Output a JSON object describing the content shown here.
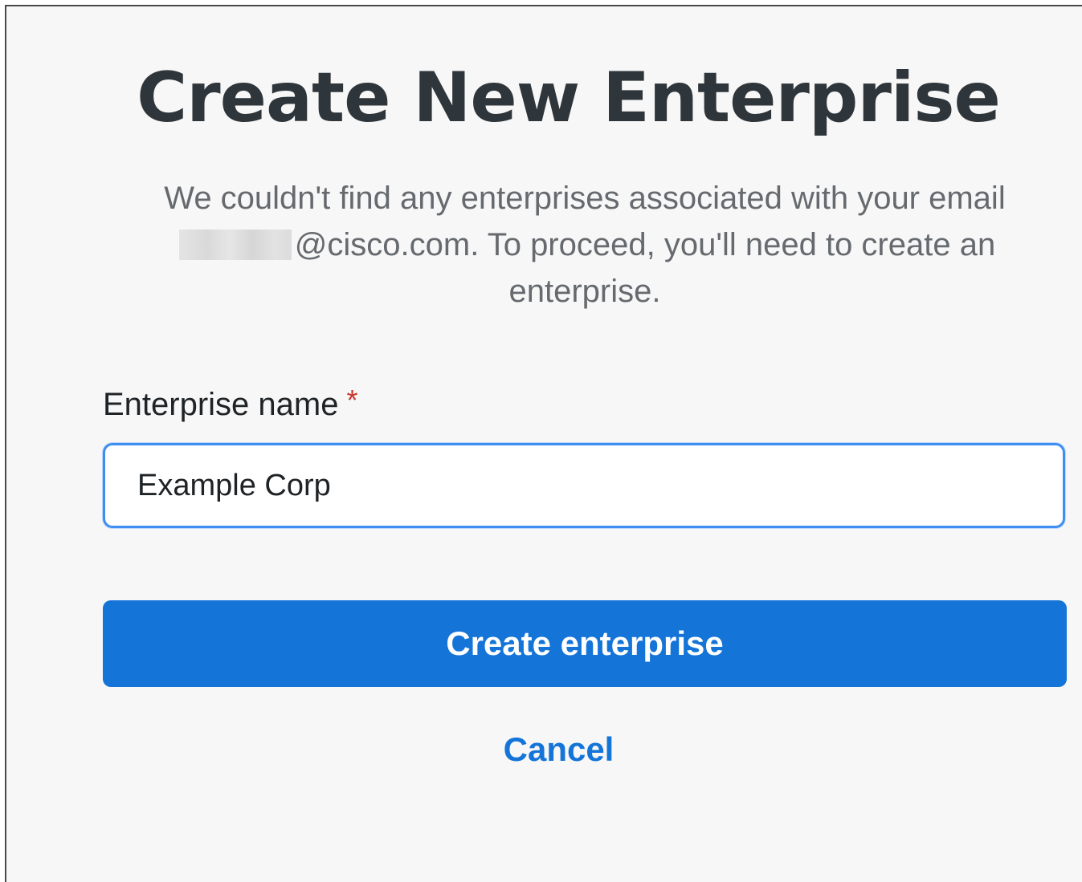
{
  "dialog": {
    "title": "Create New Enterprise",
    "description_prefix": "We couldn't find any enterprises associated with your email",
    "description_suffix": "@cisco.com. To proceed, you'll need to create an enterprise."
  },
  "form": {
    "field_label": "Enterprise name",
    "required_marker": "*",
    "input_value": "Example Corp"
  },
  "actions": {
    "submit_label": "Create enterprise",
    "cancel_label": "Cancel"
  },
  "colors": {
    "accent": "#1474d8",
    "required": "#c8382b",
    "title": "#2f363b",
    "background": "#f7f7f7"
  }
}
